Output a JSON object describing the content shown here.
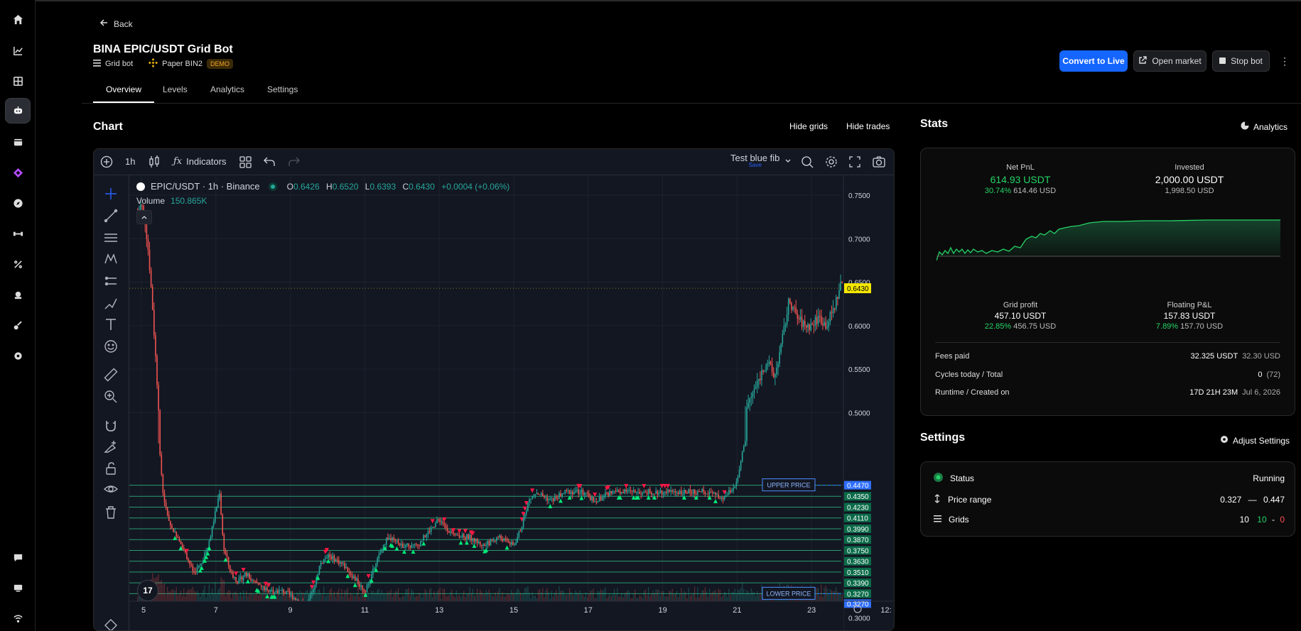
{
  "nav": {
    "back_label": "Back"
  },
  "bot": {
    "title": "BINA EPIC/USDT Grid Bot",
    "type_label": "Grid bot",
    "account_label": "Paper BIN2",
    "badge": "DEMO"
  },
  "header_actions": {
    "convert_label": "Convert to Live",
    "open_market_label": "Open market",
    "stop_label": "Stop bot"
  },
  "tabs": [
    {
      "label": "Overview",
      "active": true
    },
    {
      "label": "Levels"
    },
    {
      "label": "Analytics"
    },
    {
      "label": "Settings"
    }
  ],
  "chart_section": {
    "title": "Chart",
    "hide_grids_label": "Hide grids",
    "hide_trades_label": "Hide trades",
    "toolbar": {
      "interval": "1h",
      "indicators_label": "Indicators",
      "layout_name": "Test blue fib",
      "save_label": "Save"
    },
    "legend": {
      "symbol": "EPIC/USDT · 1h · Binance",
      "open_key": "O",
      "open": "0.6426",
      "high_key": "H",
      "high": "0.6520",
      "low_key": "L",
      "low": "0.6393",
      "close_key": "C",
      "close": "0.6430",
      "change": "+0.0004 (+0.06%)",
      "volume_label": "Volume",
      "volume": "150.865K"
    },
    "labels": {
      "upper_price": "UPPER PRICE",
      "lower_price": "LOWER PRICE"
    },
    "current_price": "0.6430",
    "tv_logo": "17"
  },
  "chart_data": {
    "type": "candlestick",
    "price_axis_ticks": [
      "0.7500",
      "0.7000",
      "0.6500",
      "0.6000",
      "0.5500",
      "0.5000",
      "0.3000"
    ],
    "date_axis_ticks": [
      "5",
      "7",
      "9",
      "11",
      "13",
      "15",
      "17",
      "19",
      "21",
      "23",
      "12:"
    ],
    "grid_levels": [
      "0.4470",
      "0.4350",
      "0.4230",
      "0.4110",
      "0.3990",
      "0.3870",
      "0.3750",
      "0.3630",
      "0.3510",
      "0.3390",
      "0.3270",
      "0.3270"
    ],
    "upper_price": 0.447,
    "lower_price": 0.327,
    "price_path": [
      [
        4.9,
        0.73
      ],
      [
        5.0,
        0.74
      ],
      [
        5.1,
        0.72
      ],
      [
        5.2,
        0.68
      ],
      [
        5.3,
        0.62
      ],
      [
        5.4,
        0.55
      ],
      [
        5.5,
        0.48
      ],
      [
        5.6,
        0.43
      ],
      [
        5.8,
        0.4
      ],
      [
        6.0,
        0.39
      ],
      [
        6.2,
        0.37
      ],
      [
        6.4,
        0.35
      ],
      [
        6.6,
        0.36
      ],
      [
        6.8,
        0.38
      ],
      [
        7.0,
        0.42
      ],
      [
        7.1,
        0.44
      ],
      [
        7.2,
        0.38
      ],
      [
        7.4,
        0.35
      ],
      [
        7.6,
        0.34
      ],
      [
        7.8,
        0.35
      ],
      [
        8.0,
        0.34
      ],
      [
        8.4,
        0.33
      ],
      [
        8.8,
        0.33
      ],
      [
        9.2,
        0.32
      ],
      [
        9.4,
        0.31
      ],
      [
        9.6,
        0.33
      ],
      [
        9.8,
        0.36
      ],
      [
        10.0,
        0.37
      ],
      [
        10.4,
        0.36
      ],
      [
        10.8,
        0.34
      ],
      [
        11.0,
        0.33
      ],
      [
        11.3,
        0.36
      ],
      [
        11.6,
        0.39
      ],
      [
        12.0,
        0.38
      ],
      [
        12.4,
        0.38
      ],
      [
        12.8,
        0.4
      ],
      [
        13.0,
        0.41
      ],
      [
        13.4,
        0.39
      ],
      [
        13.8,
        0.39
      ],
      [
        14.2,
        0.38
      ],
      [
        14.6,
        0.39
      ],
      [
        15.0,
        0.38
      ],
      [
        15.2,
        0.4
      ],
      [
        15.4,
        0.43
      ],
      [
        15.6,
        0.44
      ],
      [
        16.0,
        0.43
      ],
      [
        16.4,
        0.44
      ],
      [
        16.8,
        0.44
      ],
      [
        17.2,
        0.43
      ],
      [
        17.6,
        0.44
      ],
      [
        18.0,
        0.44
      ],
      [
        18.6,
        0.44
      ],
      [
        19.2,
        0.44
      ],
      [
        19.8,
        0.44
      ],
      [
        20.3,
        0.44
      ],
      [
        20.6,
        0.43
      ],
      [
        20.8,
        0.44
      ],
      [
        21.0,
        0.45
      ],
      [
        21.2,
        0.5
      ],
      [
        21.4,
        0.52
      ],
      [
        21.6,
        0.54
      ],
      [
        21.8,
        0.56
      ],
      [
        22.0,
        0.54
      ],
      [
        22.2,
        0.58
      ],
      [
        22.4,
        0.63
      ],
      [
        22.6,
        0.61
      ],
      [
        22.8,
        0.6
      ],
      [
        23.0,
        0.6
      ],
      [
        23.2,
        0.61
      ],
      [
        23.4,
        0.6
      ],
      [
        23.6,
        0.62
      ],
      [
        23.8,
        0.65
      ],
      [
        24.0,
        0.64
      ],
      [
        24.2,
        0.66
      ],
      [
        24.4,
        0.64
      ],
      [
        24.6,
        0.643
      ]
    ]
  },
  "stats_section": {
    "title": "Stats",
    "analytics_label": "Analytics",
    "net_pnl_label": "Net PnL",
    "net_pnl": "614.93 USDT",
    "net_pnl_pct": "30.74%",
    "net_pnl_usd": "614.46 USD",
    "invested_label": "Invested",
    "invested": "2,000.00 USDT",
    "invested_usd": "1,998.50 USD",
    "grid_profit_label": "Grid profit",
    "grid_profit": "457.10 USDT",
    "grid_profit_pct": "22.85%",
    "grid_profit_usd": "456.75 USD",
    "floating_label": "Floating P&L",
    "floating": "157.83 USDT",
    "floating_pct": "7.89%",
    "floating_usd": "157.70 USD",
    "fees_label": "Fees paid",
    "fees": "32.325 USDT",
    "fees_usd": "32.30 USD",
    "cycles_label": "Cycles today / Total",
    "cycles_today": "0",
    "cycles_total": "(72)",
    "runtime_label": "Runtime / Created on",
    "runtime": "17D 21H 23M",
    "created_on": "Jul 6, 2026"
  },
  "settings_section": {
    "title": "Settings",
    "adjust_label": "Adjust Settings",
    "status_label": "Status",
    "status_value": "Running",
    "price_range_label": "Price range",
    "price_low": "0.327",
    "price_sep": "—",
    "price_high": "0.447",
    "grids_label": "Grids",
    "grids_total": "10",
    "grids_buy": "10",
    "grids_dash": "-",
    "grids_sell": "0"
  },
  "colors": {
    "accent_blue": "#1565ff",
    "profit_green": "#25d366",
    "grid_line": "#2ebd85",
    "candle_up": "#26a69a",
    "candle_down": "#ef5350",
    "current_price_tag": "#f5e800"
  }
}
